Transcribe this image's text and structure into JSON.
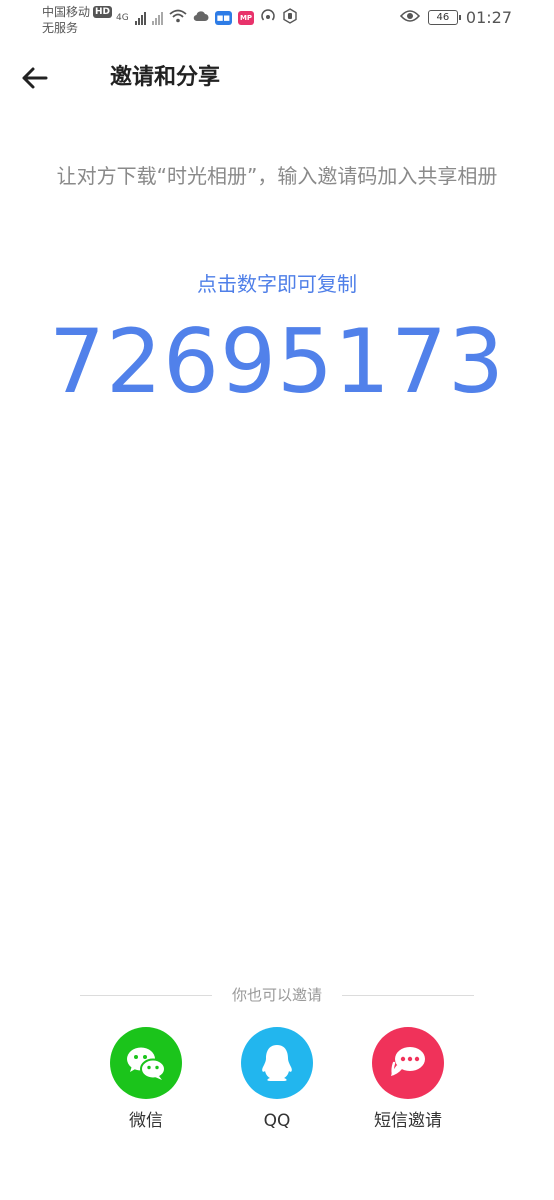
{
  "status_bar": {
    "carrier": "中国移动",
    "hd": "HD",
    "service": "无服务",
    "network": "4G",
    "battery": "46",
    "time": "01:27"
  },
  "header": {
    "title": "邀请和分享"
  },
  "main": {
    "instruction": "让对方下载“时光相册”，输入邀请码加入共享相册",
    "copy_hint": "点击数字即可复制",
    "invite_code": "72695173"
  },
  "share": {
    "caption": "你也可以邀请",
    "options": [
      {
        "label": "微信",
        "icon": "wechat-icon",
        "color": "#1bc41b"
      },
      {
        "label": "QQ",
        "icon": "qq-icon",
        "color": "#22b6ee"
      },
      {
        "label": "短信邀请",
        "icon": "sms-icon",
        "color": "#f0325a"
      }
    ]
  }
}
